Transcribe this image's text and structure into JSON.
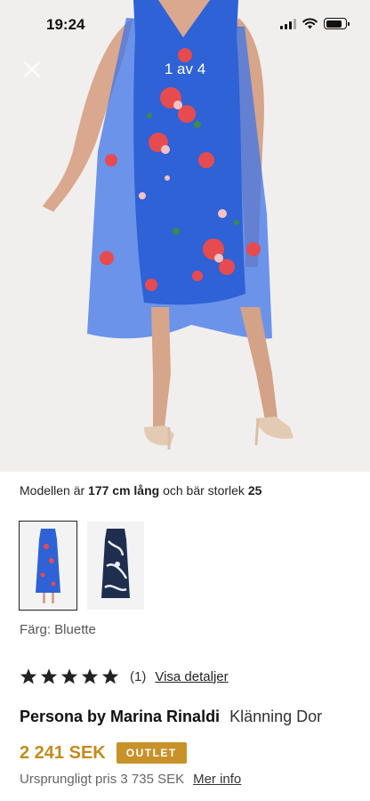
{
  "status_bar": {
    "time": "19:24",
    "battery_level": 0.85
  },
  "gallery": {
    "counter": "1 av 4"
  },
  "model": {
    "prefix": "Modellen är",
    "height": "177 cm lång",
    "middle": "och bär storlek",
    "size": "25"
  },
  "color": {
    "label": "Färg: Bluette"
  },
  "rating": {
    "stars": 5,
    "count": "(1)",
    "details_link": "Visa detaljer"
  },
  "product": {
    "brand": "Persona by Marina Rinaldi",
    "name": "Klänning Dor"
  },
  "price": {
    "current": "2 241 SEK",
    "badge": "OUTLET",
    "original": "Ursprungligt pris 3 735 SEK",
    "more_info": "Mer info"
  },
  "colors": {
    "price": "#c68a1e",
    "badge_bg": "#c8912a",
    "dress_blue": "#2e62d6"
  }
}
